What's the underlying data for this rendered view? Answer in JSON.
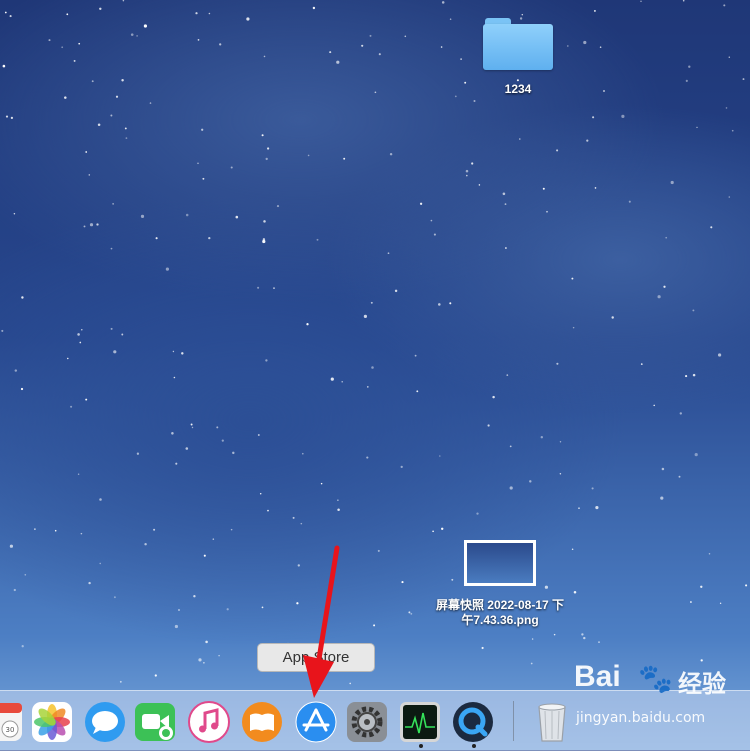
{
  "desktop": {
    "folder": {
      "label": "1234",
      "icon": "folder-icon"
    },
    "screenshot_file": {
      "label_line1": "屏幕快照 2022-08-17 下",
      "label_line2": "午7.43.36.png",
      "icon": "image-thumbnail-icon"
    }
  },
  "tooltip": {
    "text": "App Store"
  },
  "dock": {
    "items": [
      {
        "name": "calendar",
        "icon": "calendar-icon",
        "badge": "30"
      },
      {
        "name": "photos",
        "icon": "photos-icon"
      },
      {
        "name": "messages",
        "icon": "messages-icon"
      },
      {
        "name": "facetime",
        "icon": "facetime-icon"
      },
      {
        "name": "itunes",
        "icon": "itunes-icon"
      },
      {
        "name": "ibooks",
        "icon": "ibooks-icon"
      },
      {
        "name": "app-store",
        "icon": "app-store-icon"
      },
      {
        "name": "system-preferences",
        "icon": "system-preferences-icon"
      },
      {
        "name": "activity-monitor",
        "icon": "activity-monitor-icon",
        "running": true
      },
      {
        "name": "quicktime",
        "icon": "quicktime-icon",
        "running": true
      },
      {
        "name": "trash",
        "icon": "trash-icon"
      }
    ]
  },
  "watermark": {
    "brand": "Bai",
    "brand_cn": "经验",
    "url": "jingyan.baidu.com"
  },
  "colors": {
    "annotation_arrow": "#e8141b",
    "dock_bg": "#c8d7f0"
  }
}
